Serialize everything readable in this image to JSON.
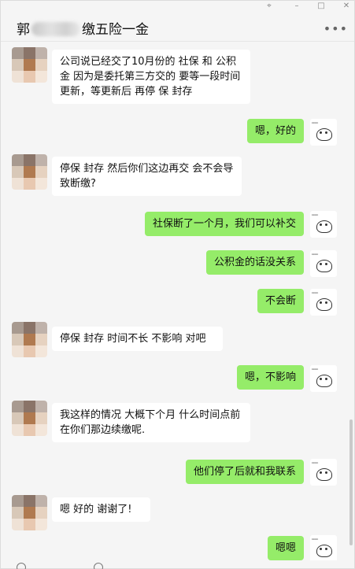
{
  "window": {
    "pin_icon": "pin-icon",
    "minimize_icon": "minimize-icon",
    "maximize_icon": "maximize-icon",
    "close_icon": "close-icon"
  },
  "header": {
    "title_prefix": "郭",
    "title_suffix": "缴五险一金",
    "more_icon": "more-icon"
  },
  "messages": [
    {
      "side": "left",
      "text": "公司说已经交了10月份的 社保 和 公积金 因为是委托第三方交的 要等一段时间 更新，等更新后 再停 保 封存"
    },
    {
      "side": "right",
      "text": "嗯，好的"
    },
    {
      "side": "left",
      "text": "停保 封存 然后你们这边再交 会不会导致断缴?"
    },
    {
      "side": "right",
      "text": "社保断了一个月，我们可以补交"
    },
    {
      "side": "right",
      "text": "公积金的话没关系"
    },
    {
      "side": "right",
      "text": "不会断"
    },
    {
      "side": "left",
      "text": "停保 封存 时间不长 不影响 对吧"
    },
    {
      "side": "right",
      "text": "嗯，不影响"
    },
    {
      "side": "left",
      "text": "我这样的情况 大概下个月 什么时间点前 在你们那边续缴呢."
    },
    {
      "side": "right",
      "text": "他们停了后就和我联系"
    },
    {
      "side": "left",
      "text": "嗯 好的 谢谢了!"
    },
    {
      "side": "right",
      "text": "嗯嗯"
    }
  ],
  "colors": {
    "right_bubble": "#95ec69",
    "left_bubble": "#ffffff",
    "background": "#f5f5f5"
  }
}
